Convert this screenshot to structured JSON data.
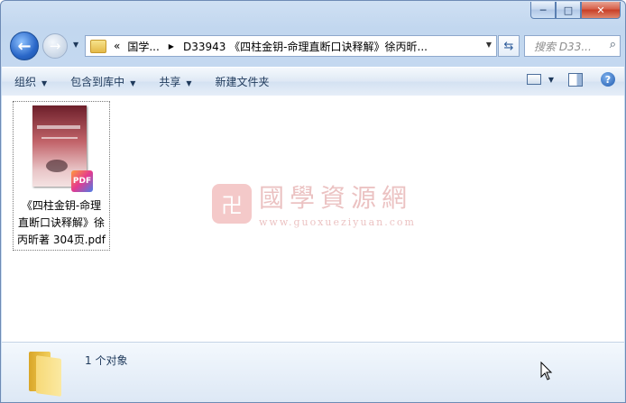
{
  "caption": {
    "minimize": "─",
    "maximize": "□",
    "close": "✕"
  },
  "nav": {
    "back_icon": "back-arrow-icon",
    "forward_icon": "forward-arrow-icon"
  },
  "address": {
    "chevrons": "«",
    "crumb1": "国学...",
    "crumb2": "D33943 《四柱金钥-命理直断口诀释解》徐丙昕..."
  },
  "search": {
    "placeholder": "搜索 D33..."
  },
  "toolbar": {
    "organize": "组织",
    "include_library": "包含到库中",
    "share": "共享",
    "new_folder": "新建文件夹"
  },
  "file": {
    "name_line1": "《四柱金钥-命理",
    "name_line2": "直断口诀释解》徐",
    "name_line3": "丙昕著 304页.pdf",
    "badge": "PDF",
    "thumb_title": "四柱金钥"
  },
  "watermark": {
    "title": "國學資源網",
    "url": "www.guoxueziyuan.com",
    "logo": "卍"
  },
  "status": {
    "count": "1 个对象"
  }
}
